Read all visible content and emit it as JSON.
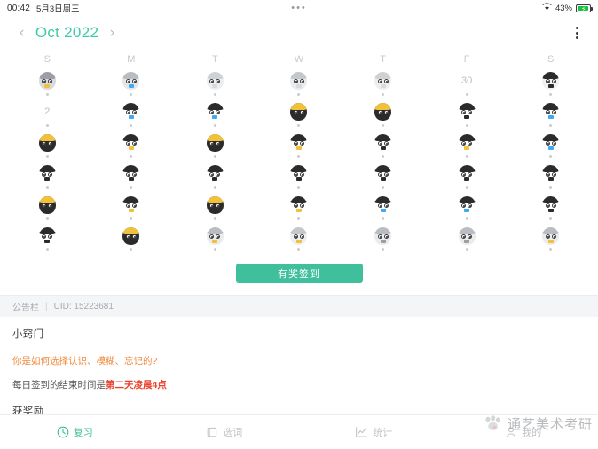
{
  "statusbar": {
    "time": "00:42",
    "date": "5月3日周三",
    "center_dots": "•••",
    "wifi_icon": "wifi-icon",
    "battery_percent": "43%",
    "battery_icon": "battery-charging-icon"
  },
  "header": {
    "prev_icon": "chevron-left-icon",
    "month_label": "Oct 2022",
    "next_icon": "chevron-right-icon",
    "overflow_icon": "kebab-menu-icon"
  },
  "calendar": {
    "weekdays": [
      "S",
      "M",
      "T",
      "W",
      "T",
      "F",
      "S"
    ],
    "weeks": [
      [
        {
          "type": "avatar",
          "hair": "#9b9ea2",
          "face": "#d8dadd",
          "mouth": "#f2c13a",
          "dot": true
        },
        {
          "type": "avatar",
          "hair": "#b9bcc0",
          "face": "#e4e6e8",
          "mouth": "#3fa9f5",
          "dot": true
        },
        {
          "type": "avatar",
          "hair": "#cfd2d5",
          "face": "#eceef0",
          "mouth": "#d8dadd",
          "dot": true
        },
        {
          "type": "avatar",
          "hair": "#c5c8cb",
          "face": "#e9ebed",
          "mouth": "#d8dadd",
          "dot": true
        },
        {
          "type": "avatar",
          "hair": "#cfd2d5",
          "face": "#eceef0",
          "mouth": "#d8dadd",
          "dot": true
        },
        {
          "type": "number",
          "label": "30",
          "dot": true
        },
        {
          "type": "avatar",
          "hair": "#2b2b2b",
          "face": "#f0f1f2",
          "mouth": "#2b2b2b",
          "dot": true
        }
      ],
      [
        {
          "type": "number",
          "label": "2",
          "dot": true
        },
        {
          "type": "avatar",
          "hair": "#2b2b2b",
          "face": "#ffffff",
          "mouth": "#3fa9f5",
          "dot": true
        },
        {
          "type": "avatar",
          "hair": "#2b2b2b",
          "face": "#ffffff",
          "mouth": "#3fa9f5",
          "dot": true
        },
        {
          "type": "avatar",
          "hair": "#f2c13a",
          "face": "#2b2b2b",
          "mouth": "#2b2b2b",
          "dot": true
        },
        {
          "type": "avatar",
          "hair": "#f2c13a",
          "face": "#2b2b2b",
          "mouth": "#2b2b2b",
          "dot": true
        },
        {
          "type": "avatar",
          "hair": "#2b2b2b",
          "face": "#ffffff",
          "mouth": "#2b2b2b",
          "dot": true
        },
        {
          "type": "avatar",
          "hair": "#2b2b2b",
          "face": "#ffffff",
          "mouth": "#3fa9f5",
          "dot": true
        }
      ],
      [
        {
          "type": "avatar",
          "hair": "#f2c13a",
          "face": "#2b2b2b",
          "mouth": "#2b2b2b",
          "dot": true
        },
        {
          "type": "avatar",
          "hair": "#2b2b2b",
          "face": "#ffffff",
          "mouth": "#f2c13a",
          "dot": true
        },
        {
          "type": "avatar",
          "hair": "#f2c13a",
          "face": "#2b2b2b",
          "mouth": "#2b2b2b",
          "dot": true
        },
        {
          "type": "avatar",
          "hair": "#2b2b2b",
          "face": "#ffffff",
          "mouth": "#f2c13a",
          "dot": true
        },
        {
          "type": "avatar",
          "hair": "#2b2b2b",
          "face": "#ffffff",
          "mouth": "#2b2b2b",
          "dot": true
        },
        {
          "type": "avatar",
          "hair": "#2b2b2b",
          "face": "#ffffff",
          "mouth": "#f2c13a",
          "dot": true
        },
        {
          "type": "avatar",
          "hair": "#2b2b2b",
          "face": "#ffffff",
          "mouth": "#3fa9f5",
          "dot": true
        }
      ],
      [
        {
          "type": "avatar",
          "hair": "#2b2b2b",
          "face": "#ffffff",
          "mouth": "#2b2b2b",
          "dot": true
        },
        {
          "type": "avatar",
          "hair": "#2b2b2b",
          "face": "#ffffff",
          "mouth": "#2b2b2b",
          "dot": true
        },
        {
          "type": "avatar",
          "hair": "#2b2b2b",
          "face": "#ffffff",
          "mouth": "#2b2b2b",
          "dot": true
        },
        {
          "type": "avatar",
          "hair": "#2b2b2b",
          "face": "#ffffff",
          "mouth": "#2b2b2b",
          "dot": true
        },
        {
          "type": "avatar",
          "hair": "#2b2b2b",
          "face": "#ffffff",
          "mouth": "#2b2b2b",
          "dot": true
        },
        {
          "type": "avatar",
          "hair": "#2b2b2b",
          "face": "#ffffff",
          "mouth": "#2b2b2b",
          "dot": true
        },
        {
          "type": "avatar",
          "hair": "#2b2b2b",
          "face": "#ffffff",
          "mouth": "#2b2b2b",
          "dot": true
        }
      ],
      [
        {
          "type": "avatar",
          "hair": "#f2c13a",
          "face": "#2b2b2b",
          "mouth": "#2b2b2b",
          "dot": true
        },
        {
          "type": "avatar",
          "hair": "#2b2b2b",
          "face": "#ffffff",
          "mouth": "#f2c13a",
          "dot": true
        },
        {
          "type": "avatar",
          "hair": "#f2c13a",
          "face": "#2b2b2b",
          "mouth": "#2b2b2b",
          "dot": true
        },
        {
          "type": "avatar",
          "hair": "#2b2b2b",
          "face": "#ffffff",
          "mouth": "#f2c13a",
          "dot": true
        },
        {
          "type": "avatar",
          "hair": "#2b2b2b",
          "face": "#ffffff",
          "mouth": "#3fa9f5",
          "dot": true
        },
        {
          "type": "avatar",
          "hair": "#2b2b2b",
          "face": "#ffffff",
          "mouth": "#3fa9f5",
          "dot": true
        },
        {
          "type": "avatar",
          "hair": "#2b2b2b",
          "face": "#ffffff",
          "mouth": "#2b2b2b",
          "dot": true
        }
      ],
      [
        {
          "type": "avatar",
          "hair": "#2b2b2b",
          "face": "#ffffff",
          "mouth": "#2b2b2b",
          "dot": true
        },
        {
          "type": "avatar",
          "hair": "#f2c13a",
          "face": "#2b2b2b",
          "mouth": "#2b2b2b",
          "dot": true
        },
        {
          "type": "avatar",
          "hair": "#b9bcc0",
          "face": "#e9ebed",
          "mouth": "#f2c13a",
          "dot": true
        },
        {
          "type": "avatar",
          "hair": "#c5c8cb",
          "face": "#eceef0",
          "mouth": "#f2c13a",
          "dot": true
        },
        {
          "type": "avatar",
          "hair": "#b9bcc0",
          "face": "#e9ebed",
          "mouth": "#9b9ea2",
          "dot": true
        },
        {
          "type": "avatar",
          "hair": "#b9bcc0",
          "face": "#e9ebed",
          "mouth": "#9b9ea2",
          "dot": true
        },
        {
          "type": "avatar",
          "hair": "#b9bcc0",
          "face": "#e9ebed",
          "mouth": "#f2c13a",
          "dot": true
        }
      ]
    ]
  },
  "checkin": {
    "label": "有奖签到",
    "color": "#3fbf9c"
  },
  "notice": {
    "label": "公告栏",
    "separator": "|",
    "uid": "UID: 15223681"
  },
  "content": {
    "title": "小窍门",
    "link": "你是如何选择认识、模糊、忘记的?",
    "line_prefix": "每日签到的结束时间是",
    "line_strong": "第二天凌晨4点",
    "subtitle": "获奖励"
  },
  "tabbar": {
    "items": [
      {
        "label": "复习",
        "icon": "clock-icon",
        "active": true
      },
      {
        "label": "选词",
        "icon": "book-icon",
        "active": false
      },
      {
        "label": "统计",
        "icon": "chart-line-icon",
        "active": false
      },
      {
        "label": "我的",
        "icon": "person-icon",
        "active": false
      }
    ]
  },
  "watermark": {
    "text": "通艺美术考研",
    "icon": "paw-logo-icon"
  },
  "colors": {
    "accent": "#3fbf9c",
    "month_accent": "#3fcaa6",
    "link": "#f08a3c",
    "strong": "#e8432e",
    "muted": "#bfc3c6"
  }
}
